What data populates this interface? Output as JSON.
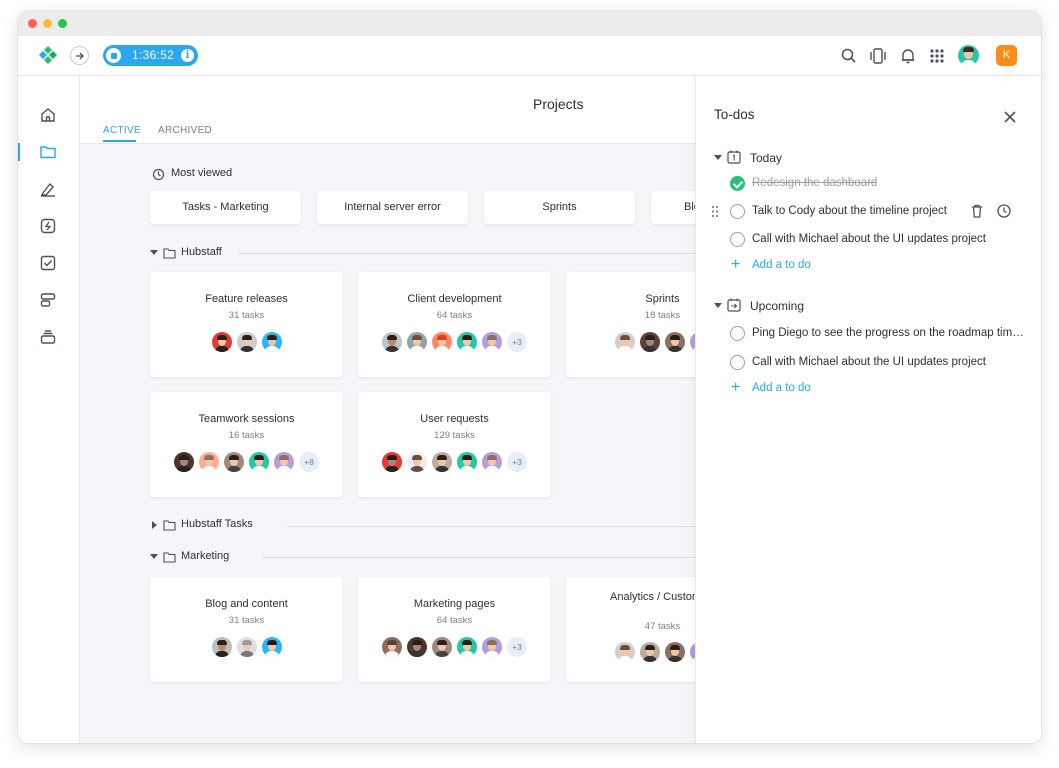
{
  "window": {
    "title": ""
  },
  "topbar": {
    "timer": "1:36:52",
    "timer_info": "i",
    "user_initial": "K"
  },
  "sidebar": {
    "items": [
      "home-icon",
      "folder-icon",
      "pen-icon",
      "activity-icon",
      "todo-icon",
      "schedule-icon",
      "inbox-icon"
    ]
  },
  "projects": {
    "title": "Projects",
    "tabs": [
      {
        "label": "ACTIVE",
        "active": true
      },
      {
        "label": "ARCHIVED",
        "active": false
      }
    ],
    "most_viewed_title": "Most viewed",
    "most_viewed": [
      "Tasks - Marketing",
      "Internal server error",
      "Sprints",
      "Blog and content"
    ],
    "groups": [
      {
        "name": "Hubstaff",
        "expanded": true,
        "projects": [
          {
            "name": "Feature releases",
            "tasks": "31 tasks",
            "avatars": 3,
            "more": ""
          },
          {
            "name": "Client development",
            "tasks": "64 tasks",
            "avatars": 5,
            "more": "+3"
          },
          {
            "name": "Sprints",
            "tasks": "18 tasks",
            "avatars": 4,
            "more": ""
          },
          {
            "name": "Teamwork sessions",
            "tasks": "16 tasks",
            "avatars": 5,
            "more": "+8"
          },
          {
            "name": "User requests",
            "tasks": "129 tasks",
            "avatars": 5,
            "more": "+3"
          }
        ]
      },
      {
        "name": "Hubstaff Tasks",
        "expanded": false,
        "projects": []
      },
      {
        "name": "Marketing",
        "expanded": true,
        "projects": [
          {
            "name": "Blog and content",
            "tasks": "31 tasks",
            "avatars": 3,
            "more": ""
          },
          {
            "name": "Marketing pages",
            "tasks": "64 tasks",
            "avatars": 5,
            "more": "+3"
          },
          {
            "name": "Analytics / Customers",
            "tasks": "47 tasks",
            "avatars": 4,
            "more": ""
          }
        ]
      }
    ]
  },
  "todos": {
    "title": "To-dos",
    "today_label": "Today",
    "today_items": [
      {
        "text": "Redesign the dashboard",
        "done": true
      },
      {
        "text": "Talk to Cody about the timeline project",
        "done": false
      },
      {
        "text": "Call with Michael about the UI updates project",
        "done": false
      }
    ],
    "add_label": "Add a to do",
    "upcoming_label": "Upcoming",
    "upcoming_items": [
      {
        "text": "Ping Diego to see the progress on the roadmap timeline",
        "done": false
      },
      {
        "text": "Call with Michael about the UI updates project",
        "done": false
      }
    ]
  },
  "colors": {
    "accent": "#2aa7f0",
    "done": "#23c277",
    "user_badge": "#fb8c1a",
    "panel_bg": "#f4f6f9"
  }
}
